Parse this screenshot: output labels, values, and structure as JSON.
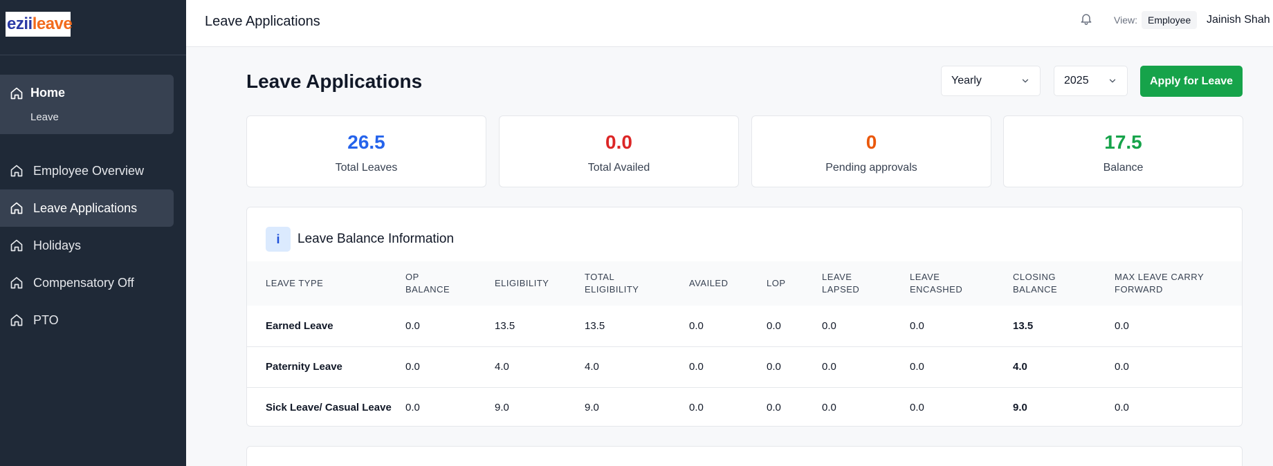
{
  "brand": {
    "part1": "ezii",
    "part2": "leave"
  },
  "sidebar": {
    "home": {
      "label": "Home",
      "sub": "Leave"
    },
    "items": [
      {
        "label": "Employee Overview",
        "icon": "home-icon"
      },
      {
        "label": "Leave Applications",
        "icon": "home-icon",
        "active": true
      },
      {
        "label": "Holidays",
        "icon": "home-icon"
      },
      {
        "label": "Compensatory Off",
        "icon": "home-icon"
      },
      {
        "label": "PTO",
        "icon": "home-icon"
      }
    ]
  },
  "header": {
    "title": "Leave Applications",
    "view_label": "View:",
    "view_value": "Employee",
    "user": "Jainish Shah"
  },
  "main": {
    "title": "Leave Applications",
    "period": "Yearly",
    "year": "2025",
    "apply_label": "Apply for Leave"
  },
  "stats": [
    {
      "value": "26.5",
      "caption": "Total Leaves",
      "color": "#2563eb"
    },
    {
      "value": "0.0",
      "caption": "Total Availed",
      "color": "#dc2626"
    },
    {
      "value": "0",
      "caption": "Pending approvals",
      "color": "#ea580c"
    },
    {
      "value": "17.5",
      "caption": "Balance",
      "color": "#16a34a"
    }
  ],
  "balance": {
    "icon_letter": "i",
    "title": "Leave Balance Information",
    "columns": [
      [
        "LEAVE TYPE"
      ],
      [
        "OP",
        "BALANCE"
      ],
      [
        "ELIGIBILITY"
      ],
      [
        "TOTAL",
        "ELIGIBILITY"
      ],
      [
        "AVAILED"
      ],
      [
        "LOP"
      ],
      [
        "LEAVE",
        "LAPSED"
      ],
      [
        "LEAVE",
        "ENCASHED"
      ],
      [
        "CLOSING",
        "BALANCE"
      ],
      [
        "MAX LEAVE CARRY",
        "FORWARD"
      ]
    ],
    "rows": [
      [
        "Earned Leave",
        "0.0",
        "13.5",
        "13.5",
        "0.0",
        "0.0",
        "0.0",
        "0.0",
        "13.5",
        "0.0"
      ],
      [
        "Paternity Leave",
        "0.0",
        "4.0",
        "4.0",
        "0.0",
        "0.0",
        "0.0",
        "0.0",
        "4.0",
        "0.0"
      ],
      [
        "Sick Leave/ Casual Leave",
        "0.0",
        "9.0",
        "9.0",
        "0.0",
        "0.0",
        "0.0",
        "0.0",
        "9.0",
        "0.0"
      ]
    ]
  }
}
